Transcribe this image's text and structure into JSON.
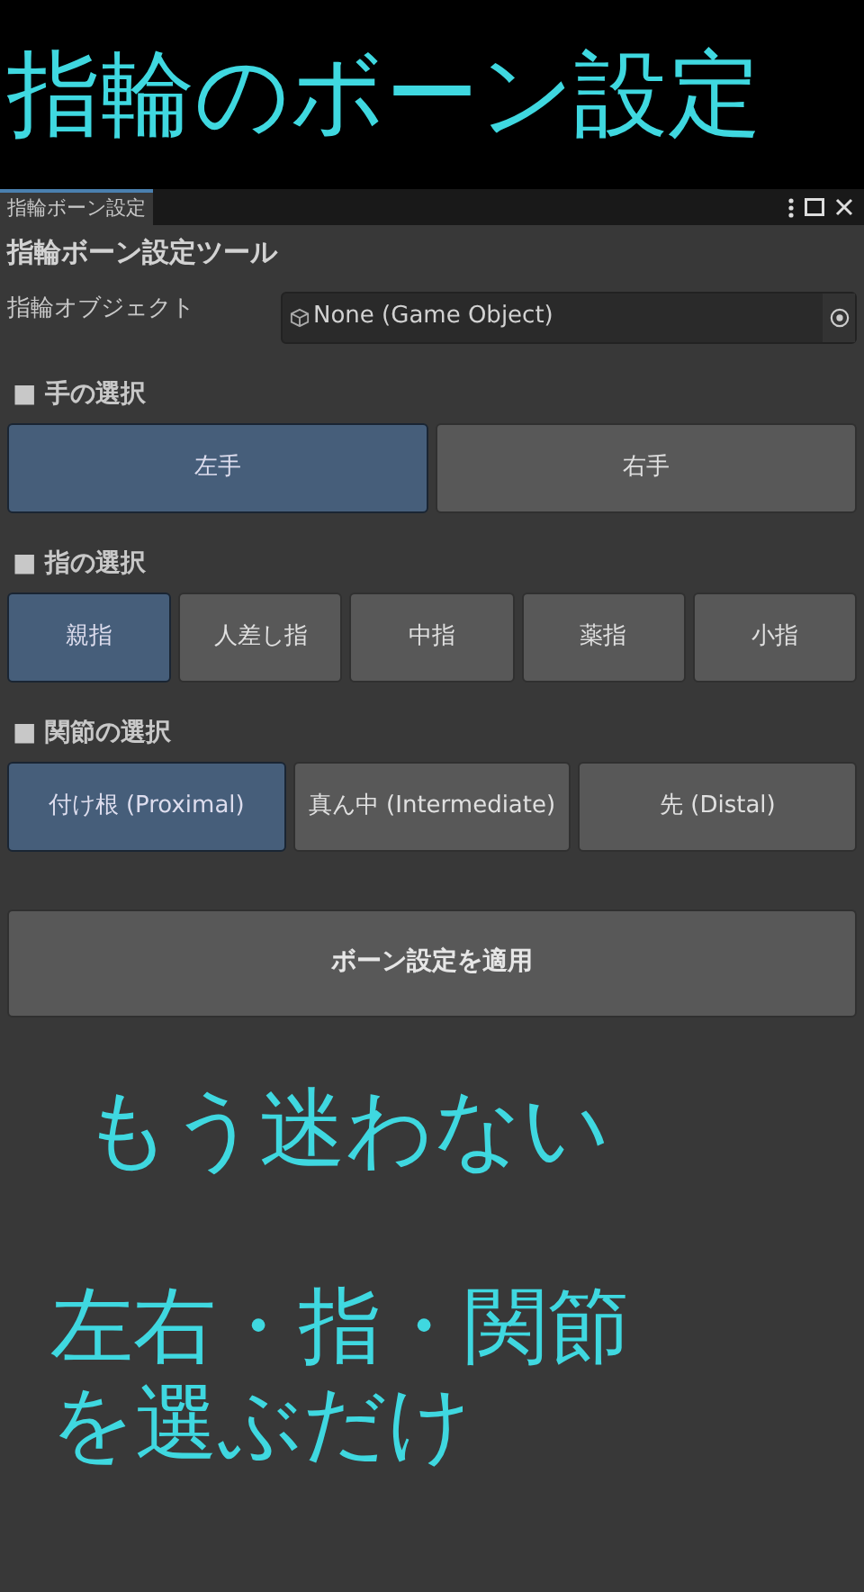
{
  "banner": {
    "title": "指輪のボーン設定"
  },
  "window": {
    "tab": "指輪ボーン設定",
    "title": "指輪ボーン設定ツール"
  },
  "object_field": {
    "label": "指輪オブジェクト",
    "value": "None (Game Object)"
  },
  "sections": [
    {
      "heading": "■ 手の選択",
      "options": [
        {
          "label": "左手",
          "selected": true
        },
        {
          "label": "右手",
          "selected": false
        }
      ]
    },
    {
      "heading": "■ 指の選択",
      "options": [
        {
          "label": "親指",
          "selected": true
        },
        {
          "label": "人差し指",
          "selected": false
        },
        {
          "label": "中指",
          "selected": false
        },
        {
          "label": "薬指",
          "selected": false
        },
        {
          "label": "小指",
          "selected": false
        }
      ]
    },
    {
      "heading": "■ 関節の選択",
      "options": [
        {
          "label": "付け根 (Proximal)",
          "selected": true
        },
        {
          "label": "真ん中 (Intermediate)",
          "selected": false
        },
        {
          "label": "先 (Distal)",
          "selected": false
        }
      ]
    }
  ],
  "apply_button": "ボーン設定を適用",
  "captions": [
    "もう迷わない",
    "左右・指・関節",
    "を選ぶだけ"
  ]
}
